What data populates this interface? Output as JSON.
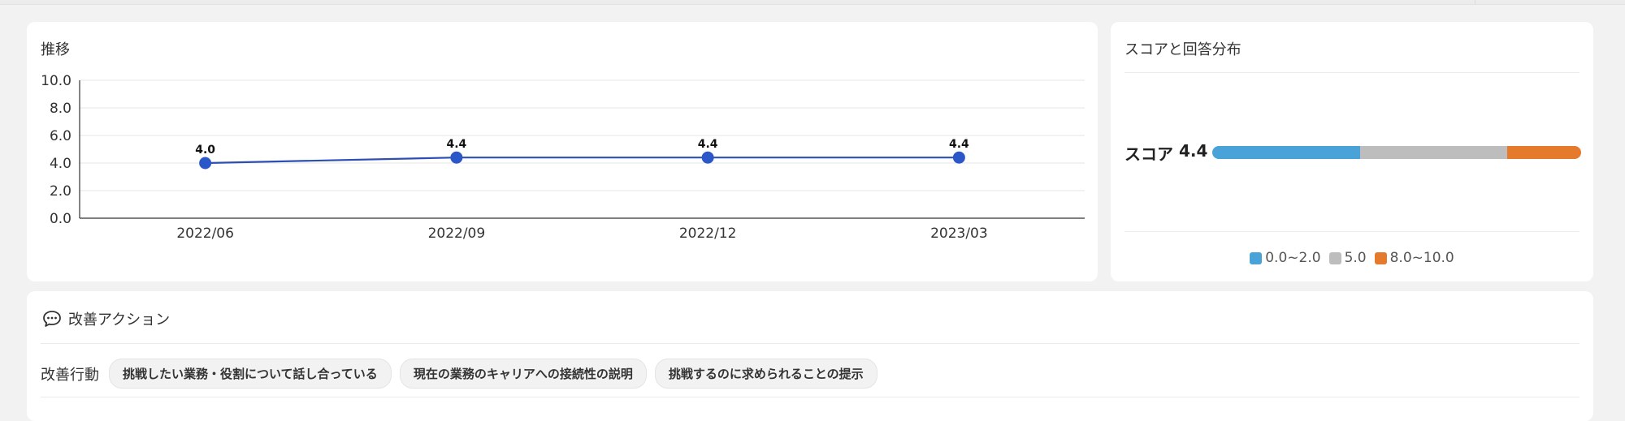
{
  "trend": {
    "title": "推移"
  },
  "chart_data": {
    "type": "line",
    "categories": [
      "2022/06",
      "2022/09",
      "2022/12",
      "2023/03"
    ],
    "values": [
      4.0,
      4.4,
      4.4,
      4.4
    ],
    "data_labels": [
      "4.0",
      "4.4",
      "4.4",
      "4.4"
    ],
    "ylim": [
      0,
      10
    ],
    "y_ticks": [
      "0.0",
      "2.0",
      "4.0",
      "6.0",
      "8.0",
      "10.0"
    ],
    "grid": true,
    "line_color": "#2b4fb3",
    "point_color": "#2b57c9"
  },
  "score": {
    "title": "スコアと回答分布",
    "label": "スコア",
    "value": "4.4",
    "distribution": [
      {
        "label": "0.0~2.0",
        "share": 0.4,
        "color": "#4aa3d8"
      },
      {
        "label": "5.0",
        "share": 0.4,
        "color": "#bdbdbd"
      },
      {
        "label": "8.0~10.0",
        "share": 0.2,
        "color": "#e57a2c"
      }
    ]
  },
  "actions": {
    "title": "改善アクション",
    "icon": "speech-bubble-icon",
    "row_label": "改善行動",
    "chips": [
      "挑戦したい業務・役割について話し合っている",
      "現在の業務のキャリアへの接続性の説明",
      "挑戦するのに求められることの提示"
    ]
  }
}
